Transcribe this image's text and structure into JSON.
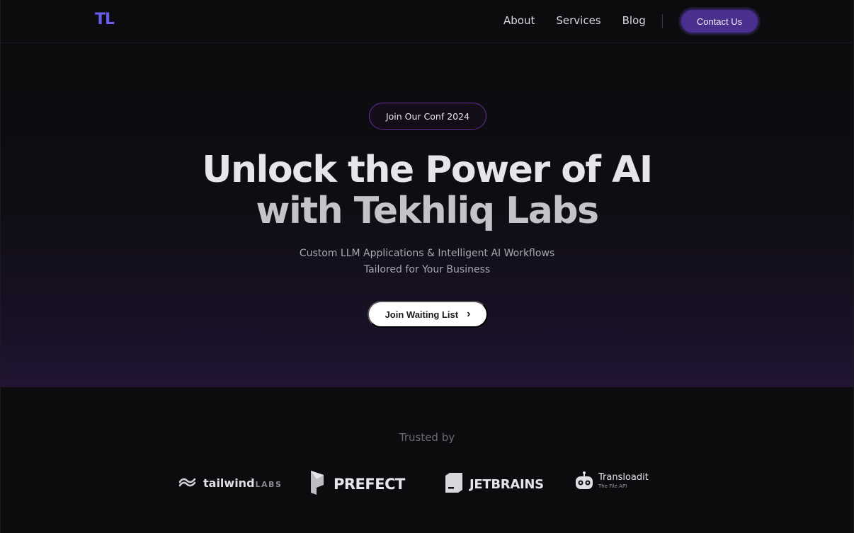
{
  "nav": {
    "logo": "TL",
    "links": [
      {
        "label": "About"
      },
      {
        "label": "Services"
      },
      {
        "label": "Blog"
      }
    ],
    "contact_label": "Contact Us"
  },
  "hero": {
    "badge_label": "Join Our Conf 2024",
    "headline_line1": "Unlock the Power of AI",
    "headline_line2": "with Tekhliq Labs",
    "subtitle_line1": "Custom LLM Applications & Intelligent AI Workflows",
    "subtitle_line2": "Tailored for Your Business",
    "cta_label": "Join Waiting List"
  },
  "trusted": {
    "label": "Trusted by",
    "logos": [
      {
        "name": "tailwind",
        "suffix": "LABS",
        "icon": "tailwind-wave-icon"
      },
      {
        "name": "PREFECT",
        "icon": "prefect-mark-icon"
      },
      {
        "name": "JETBRAINS",
        "icon": "jetbrains-cube-icon"
      },
      {
        "name": "Transloadit",
        "tagline": "The File API",
        "icon": "transloadit-robot-icon"
      }
    ]
  },
  "colors": {
    "background": "#0c0c0e",
    "accent": "#4b2f8f",
    "logo": "#6b5cf0",
    "badge_border": "#6b2fa0"
  }
}
